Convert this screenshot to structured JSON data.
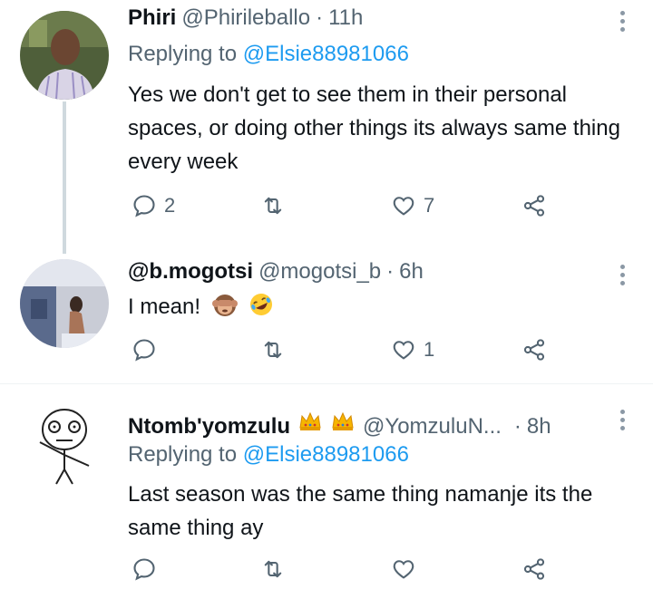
{
  "tweets": [
    {
      "name": "Phiri",
      "handle": "@Phirileballo",
      "dot": "·",
      "time": "11h",
      "replying_prefix": "Replying to",
      "replying_to": "@Elsie88981066",
      "text": "Yes we don't get to see them in their personal spaces, or doing other things its always same thing every week",
      "replies": "2",
      "retweets": "",
      "likes": "7"
    },
    {
      "name": "@b.mogotsi",
      "handle": "@mogotsi_b",
      "dot": "·",
      "time": "6h",
      "text": "I mean!",
      "emojis": [
        "see-no-evil-monkey-emoji",
        "rolling-on-floor-laughing-emoji"
      ],
      "replies": "",
      "retweets": "",
      "likes": "1"
    },
    {
      "name": "Ntomb'yomzulu",
      "name_emojis": [
        "crown-emoji",
        "crown-emoji"
      ],
      "handle": "@YomzuluN...",
      "dot": "·",
      "time": "8h",
      "replying_prefix": "Replying to",
      "replying_to": "@Elsie88981066",
      "text": "Last season was the same thing namanje its the same thing ay",
      "replies": "",
      "retweets": "",
      "likes": ""
    }
  ],
  "icons": [
    "reply-icon",
    "retweet-icon",
    "like-icon",
    "share-icon",
    "more-options-icon"
  ],
  "colors": {
    "text": "#0f1419",
    "secondary": "#536471",
    "link": "#1d9bf0",
    "divider": "#eff3f4"
  }
}
